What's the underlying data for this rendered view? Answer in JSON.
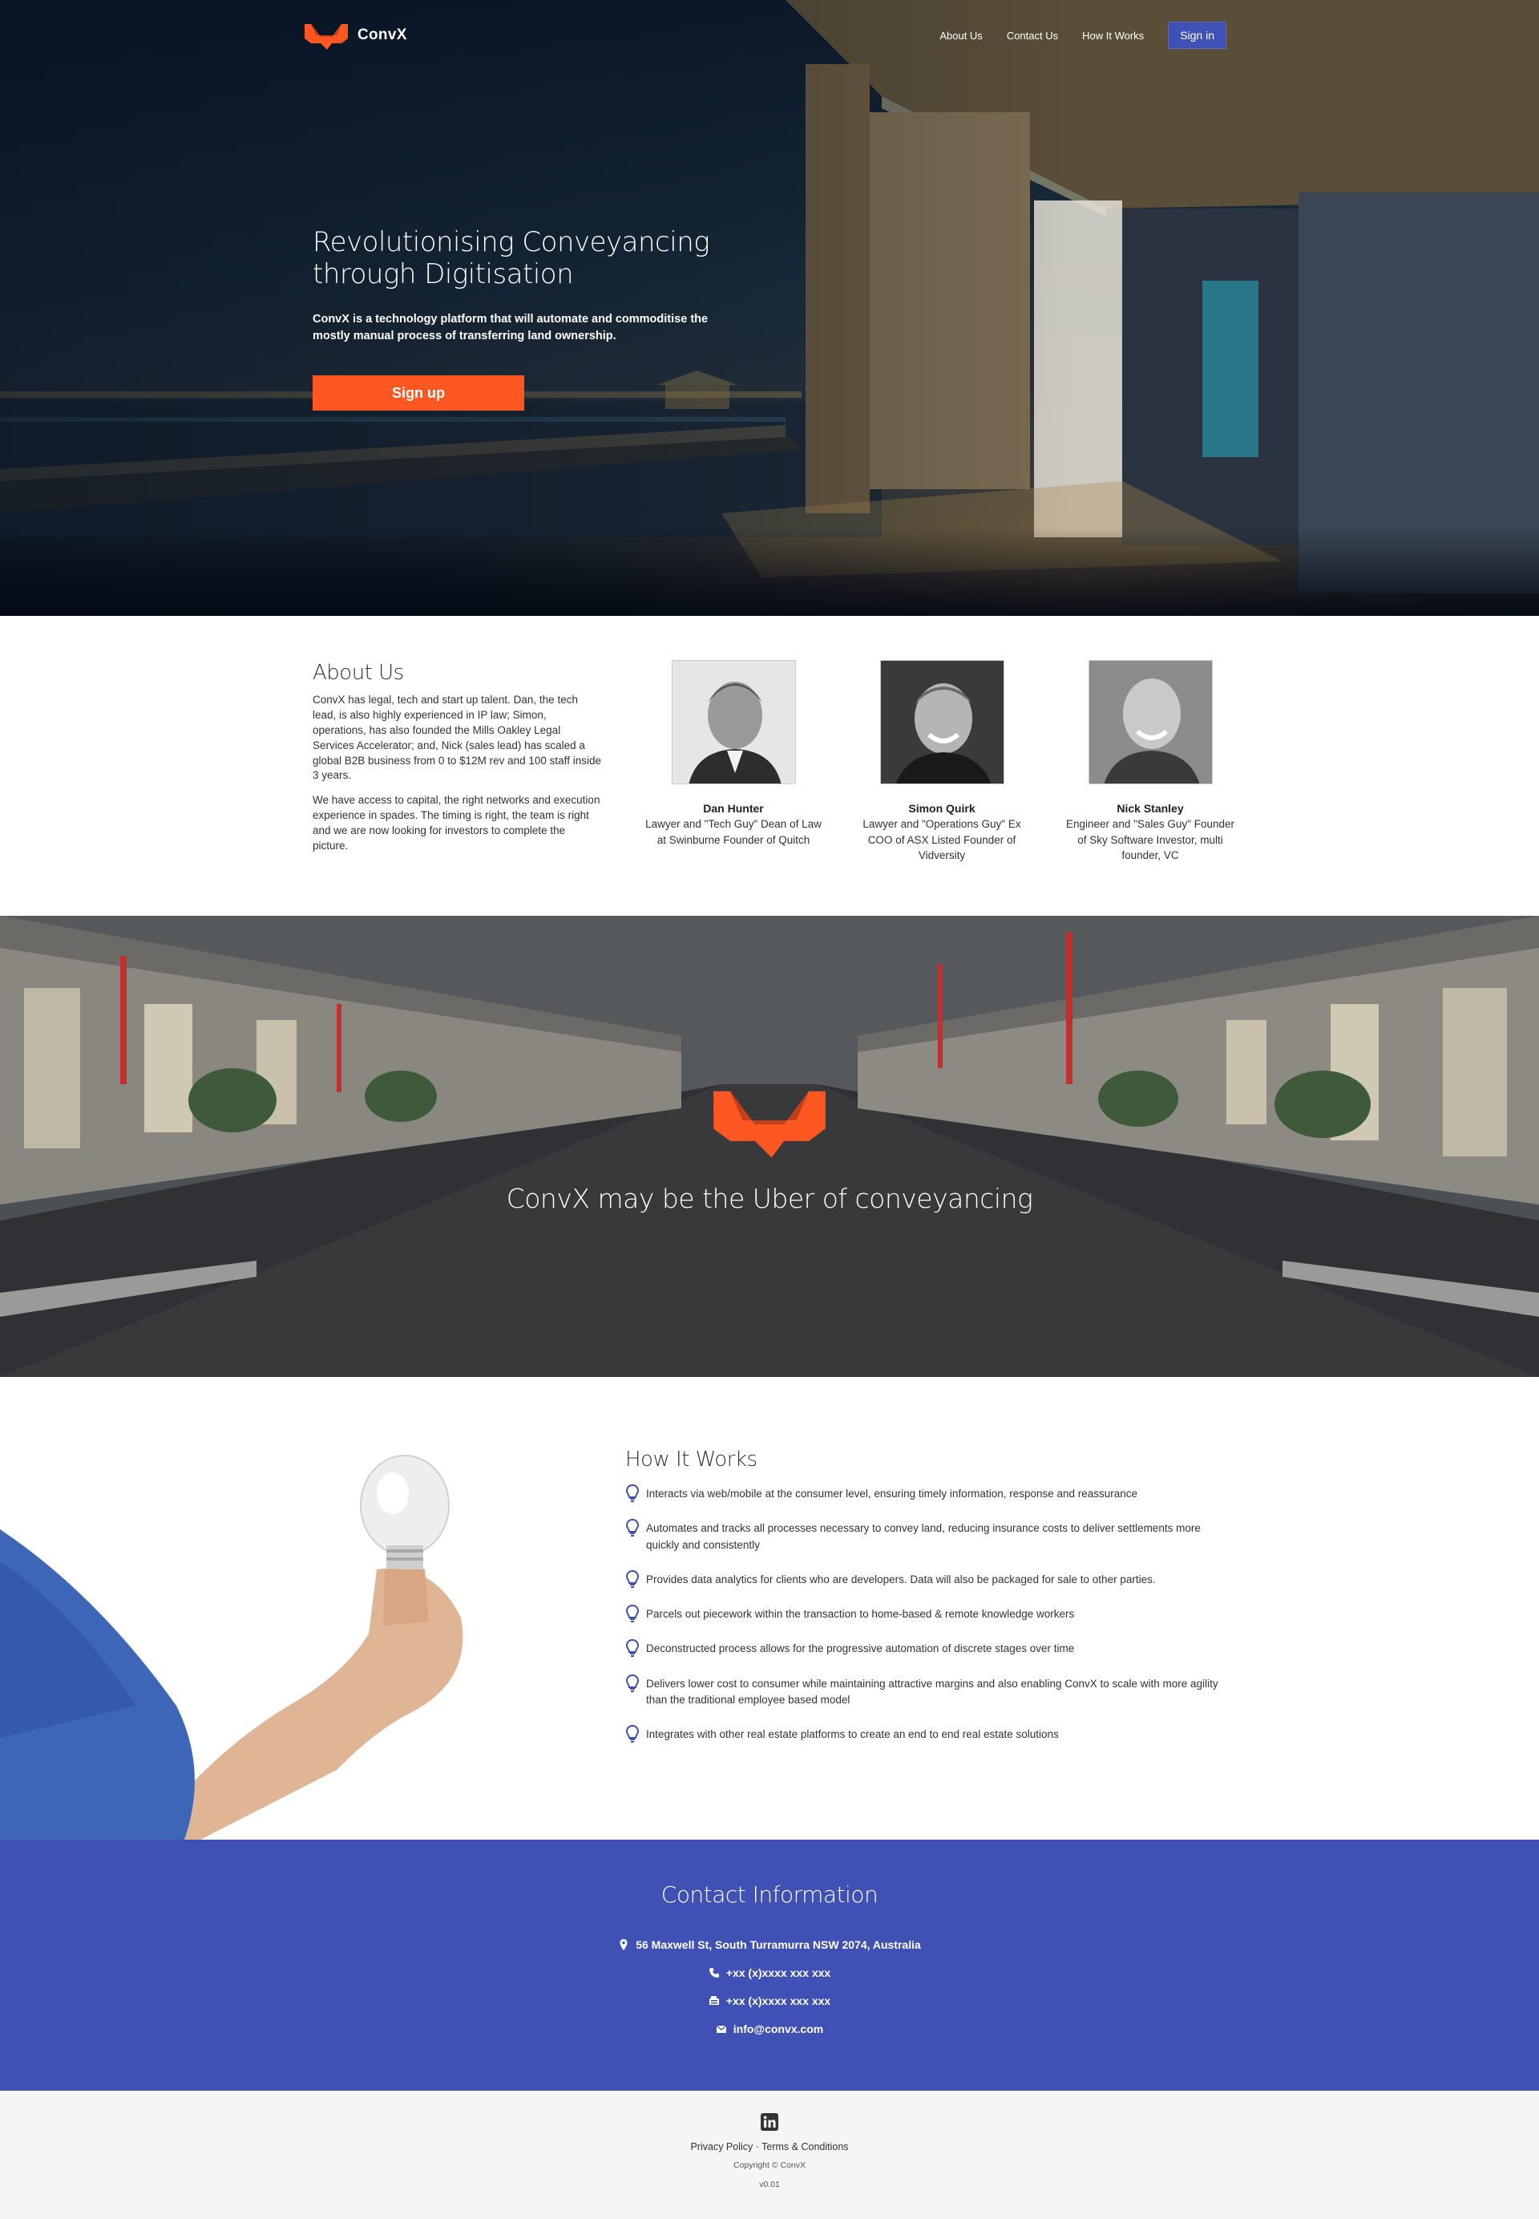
{
  "brand": {
    "name": "ConvX",
    "accent": "#ff5722",
    "primary": "#3f51b5"
  },
  "nav": {
    "links": [
      {
        "label": "About Us"
      },
      {
        "label": "Contact Us"
      },
      {
        "label": "How It Works"
      }
    ],
    "signin_label": "Sign in"
  },
  "hero": {
    "title": "Revolutionising Conveyancing through Digitisation",
    "subtitle": "ConvX is a technology platform that will automate and commoditise the mostly manual process of transferring land ownership.",
    "cta_label": "Sign up"
  },
  "about": {
    "heading": "About Us",
    "paragraphs": [
      "ConvX has legal, tech and start up talent. Dan, the tech lead, is also highly experienced in IP law; Simon, operations, has also founded the Mills Oakley Legal Services Accelerator; and, Nick (sales lead) has scaled a global B2B business from 0 to $12M rev and 100 staff inside 3 years.",
      "We have access to capital, the right networks and execution experience in spades. The timing is right, the team is right and we are now looking for investors to complete the picture."
    ],
    "team": [
      {
        "name": "Dan Hunter",
        "role": "Lawyer and \"Tech Guy\" Dean of Law at Swinburne Founder of Quitch"
      },
      {
        "name": "Simon Quirk",
        "role": "Lawyer and \"Operations Guy\" Ex COO of ASX Listed Founder of Vidversity"
      },
      {
        "name": "Nick Stanley",
        "role": "Engineer and \"Sales Guy\" Founder of Sky Software Investor, multi founder, VC"
      }
    ]
  },
  "banner": {
    "text": "ConvX may be the Uber of conveyancing"
  },
  "how": {
    "heading": "How It Works",
    "items": [
      "Interacts via web/mobile at the consumer level, ensuring timely information, response and reassurance",
      "Automates and tracks all processes necessary to convey land, reducing insurance costs to deliver settlements more quickly and consistently",
      "Provides data analytics for clients who are developers. Data will also be packaged for sale to other parties.",
      "Parcels out piecework within the transaction to home-based & remote knowledge workers",
      "Deconstructed process allows for the progressive automation of discrete stages over time",
      "Delivers lower cost to consumer while maintaining attractive margins and also enabling ConvX to scale with more agility than the traditional employee based model",
      "Integrates with other real estate platforms to create an end to end real estate solutions"
    ]
  },
  "contact": {
    "heading": "Contact Information",
    "address": "56 Maxwell St, South Turramurra NSW 2074, Australia",
    "phone": "+xx (x)xxxx xxx xxx",
    "fax": "+xx (x)xxxx xxx xxx",
    "email": "info@convx.com"
  },
  "footer": {
    "privacy": "Privacy Policy",
    "separator": " · ",
    "terms": "Terms & Conditions",
    "copyright": "Copyright © ConvX",
    "version": "v0.01",
    "social_icon": "linkedin-icon"
  }
}
